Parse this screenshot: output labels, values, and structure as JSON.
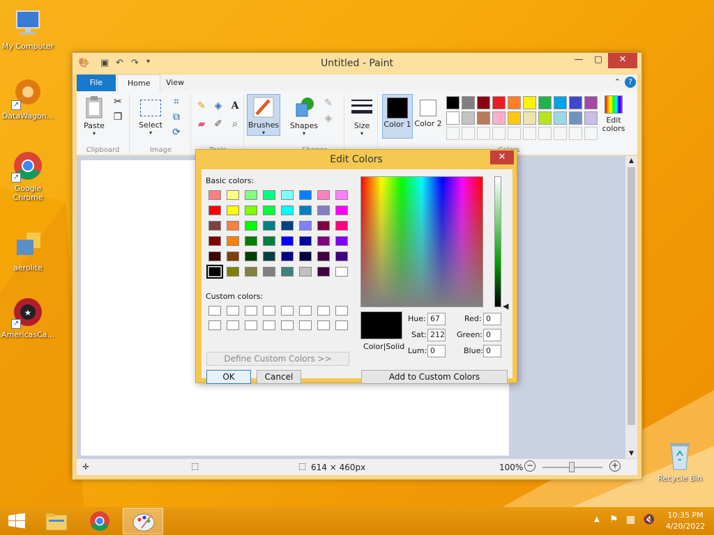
{
  "desktop": {
    "icons": [
      {
        "label": "My Computer"
      },
      {
        "label": "DataWagon..."
      },
      {
        "label": "Google Chrome"
      },
      {
        "label": "aerolite"
      },
      {
        "label": "AmericasCa..."
      },
      {
        "label": "Recycle Bin"
      }
    ]
  },
  "paint": {
    "title": "Untitled - Paint",
    "tabs": {
      "file": "File",
      "home": "Home",
      "view": "View"
    },
    "groups": {
      "clipboard": "Clipboard",
      "image": "Image",
      "tools": "Tools",
      "shapes": "Shapes",
      "colors": "Colors"
    },
    "buttons": {
      "paste": "Paste",
      "select": "Select",
      "brushes": "Brushes",
      "shapes": "Shapes",
      "size": "Size",
      "color1": "Color 1",
      "color2": "Color 2",
      "edit_colors": "Edit colors"
    },
    "palette_row1": [
      "#000000",
      "#7f7f7f",
      "#880015",
      "#ed1c24",
      "#ff7f27",
      "#fff200",
      "#22b14c",
      "#00a2e8",
      "#3f48cc",
      "#a349a4"
    ],
    "palette_row2": [
      "#ffffff",
      "#c3c3c3",
      "#b97a57",
      "#ffaec9",
      "#ffc90e",
      "#efe4b0",
      "#b5e61d",
      "#99d9ea",
      "#7092be",
      "#c8bfe7"
    ],
    "status": {
      "size": "614 × 460px",
      "zoom": "100%"
    }
  },
  "dialog": {
    "title": "Edit Colors",
    "basic_label": "Basic colors:",
    "custom_label": "Custom colors:",
    "define_button": "Define Custom Colors >>",
    "ok": "OK",
    "cancel": "Cancel",
    "add_button": "Add to Custom Colors",
    "color_solid": "Color|Solid",
    "labels": {
      "hue": "Hue:",
      "sat": "Sat:",
      "lum": "Lum:",
      "red": "Red:",
      "green": "Green:",
      "blue": "Blue:"
    },
    "values": {
      "hue": "67",
      "sat": "212",
      "lum": "0",
      "red": "0",
      "green": "0",
      "blue": "0"
    },
    "basic_colors": [
      [
        "#ff8080",
        "#ffff80",
        "#80ff80",
        "#00ff80",
        "#80ffff",
        "#0080ff",
        "#ff80c0",
        "#ff80ff"
      ],
      [
        "#ff0000",
        "#ffff00",
        "#80ff00",
        "#00ff40",
        "#00ffff",
        "#0080c0",
        "#8080c0",
        "#ff00ff"
      ],
      [
        "#804040",
        "#ff8040",
        "#00ff00",
        "#008080",
        "#004080",
        "#8080ff",
        "#800040",
        "#ff0080"
      ],
      [
        "#800000",
        "#ff8000",
        "#008000",
        "#008040",
        "#0000ff",
        "#0000a0",
        "#800080",
        "#8000ff"
      ],
      [
        "#400000",
        "#804000",
        "#004000",
        "#004040",
        "#000080",
        "#000040",
        "#400040",
        "#400080"
      ],
      [
        "#000000",
        "#808000",
        "#808040",
        "#808080",
        "#408080",
        "#c0c0c0",
        "#400040",
        "#ffffff"
      ]
    ]
  },
  "taskbar": {
    "time": "10:35 PM",
    "date": "4/20/2022"
  }
}
